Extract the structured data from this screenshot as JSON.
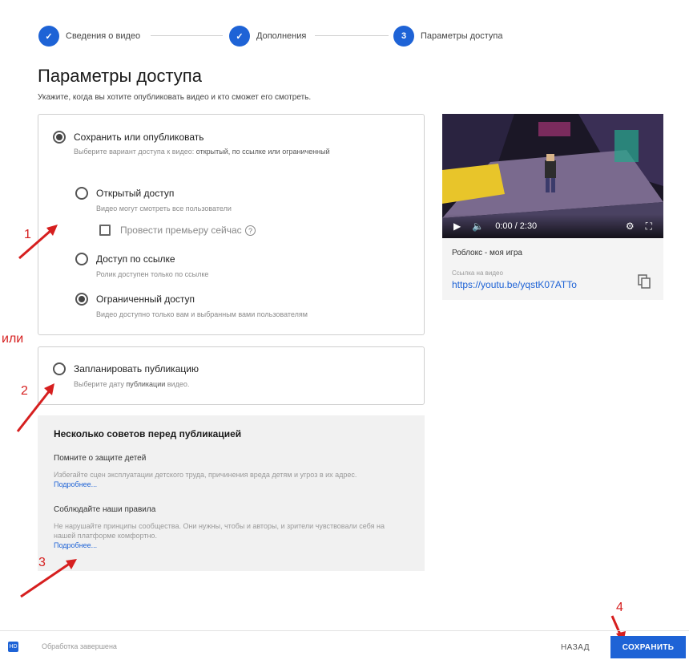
{
  "stepper": {
    "steps": [
      {
        "label": "Сведения о видео",
        "number": "✓"
      },
      {
        "label": "Дополнения",
        "number": "✓"
      },
      {
        "label": "Параметры доступа",
        "number": "3"
      }
    ]
  },
  "page": {
    "title": "Параметры доступа",
    "subtitle": "Укажите, когда вы хотите опубликовать видео и кто сможет его смотреть."
  },
  "save_publish": {
    "title": "Сохранить или опубликовать",
    "desc_plain": "Выберите вариант доступа к видео:",
    "desc_bold": "открытый, по ссылке или ограниченный",
    "options": [
      {
        "title": "Открытый доступ",
        "desc": "Видео могут смотреть все пользователи"
      },
      {
        "title": "Доступ по ссылке",
        "desc": "Ролик доступен только по ссылке"
      },
      {
        "title": "Ограниченный доступ",
        "desc": "Видео доступно только вам и выбранным вами пользователям"
      }
    ],
    "premiere_label": "Провести премьеру сейчас",
    "help_glyph": "?"
  },
  "schedule": {
    "title": "Запланировать публикацию",
    "desc_plain": "Выберите дату",
    "desc_bold": "публикации",
    "desc_end": "видео."
  },
  "tips": {
    "title": "Несколько советов перед публикацией",
    "items": [
      {
        "heading": "Помните о защите детей",
        "text": "Избегайте сцен эксплуатации детского труда, причинения вреда детям и угроз в их адрес.",
        "link": "Подробнее..."
      },
      {
        "heading": "Соблюдайте наши правила",
        "text": "Не нарушайте принципы сообщества. Они нужны, чтобы и авторы, и зрители чувствовали себя на нашей платформе комфортно.",
        "link": "Подробнее..."
      }
    ]
  },
  "video": {
    "time": "0:00 / 2:30",
    "title": "Роблокс - моя игра",
    "link_label": "Ссылка на видео",
    "link": "https://youtu.be/yqstK07ATTo"
  },
  "annotations": {
    "n1": "1",
    "or": "или",
    "n2": "2",
    "n3": "3",
    "n4": "4"
  },
  "footer": {
    "status_icon": "HD",
    "status": "Обработка завершена",
    "back": "НАЗАД",
    "save": "СОХРАНИТЬ"
  },
  "colors": {
    "accent": "#1e63d6",
    "annotation": "#d61f1f",
    "tips_bg": "#f1f1f1"
  }
}
